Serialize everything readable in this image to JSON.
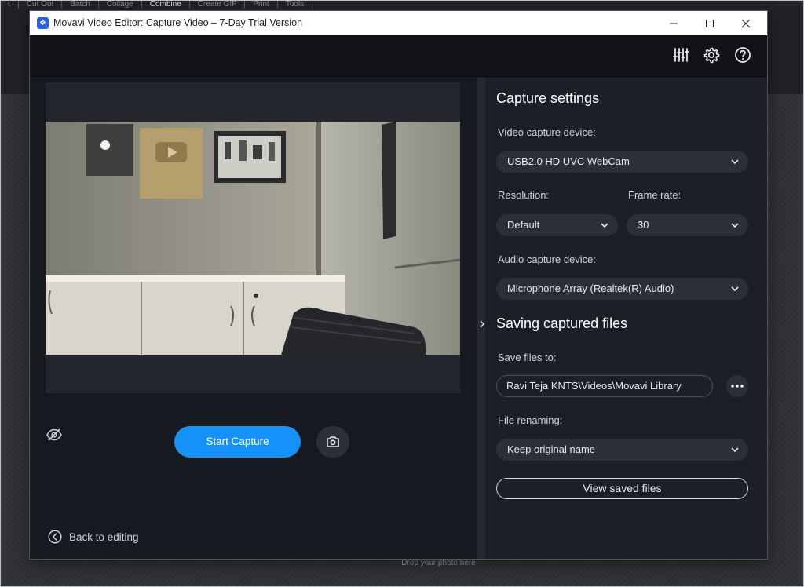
{
  "background": {
    "menu_items": [
      "t",
      "Cut Out",
      "Batch",
      "Collage",
      "Combine",
      "Create GIF",
      "Print",
      "Tools"
    ],
    "drop_hint": "Drop your photo here"
  },
  "window": {
    "title": "Movavi Video Editor: Capture Video – 7-Day Trial Version",
    "icons": {
      "app": "movavi-logo-icon",
      "minimize": "minimize-icon",
      "maximize": "maximize-icon",
      "close": "close-icon"
    }
  },
  "toolbar": {
    "icons": [
      "equalizer-icon",
      "gear-icon",
      "help-icon"
    ]
  },
  "left": {
    "start_capture_label": "Start Capture",
    "back_label": "Back to editing",
    "icons": {
      "hide_preview": "eye-off-icon",
      "snapshot": "camera-icon",
      "back": "arrow-left-circle-icon"
    }
  },
  "capture_settings": {
    "title": "Capture settings",
    "video_device_label": "Video capture device:",
    "video_device_value": "USB2.0 HD UVC WebCam",
    "resolution_label": "Resolution:",
    "resolution_value": "Default",
    "frame_rate_label": "Frame rate:",
    "frame_rate_value": "30",
    "audio_device_label": "Audio capture device:",
    "audio_device_value": "Microphone Array (Realtek(R) Audio)"
  },
  "saving": {
    "title": "Saving captured files",
    "save_to_label": "Save files to:",
    "save_to_value": "Ravi Teja KNTS\\Videos\\Movavi Library",
    "renaming_label": "File renaming:",
    "renaming_value": "Keep original name",
    "view_saved_label": "View saved files"
  },
  "colors": {
    "accent": "#1591f7",
    "window_bg": "#16191f",
    "panel_bg": "#1c1f27",
    "control_bg": "#2b2f3a"
  }
}
